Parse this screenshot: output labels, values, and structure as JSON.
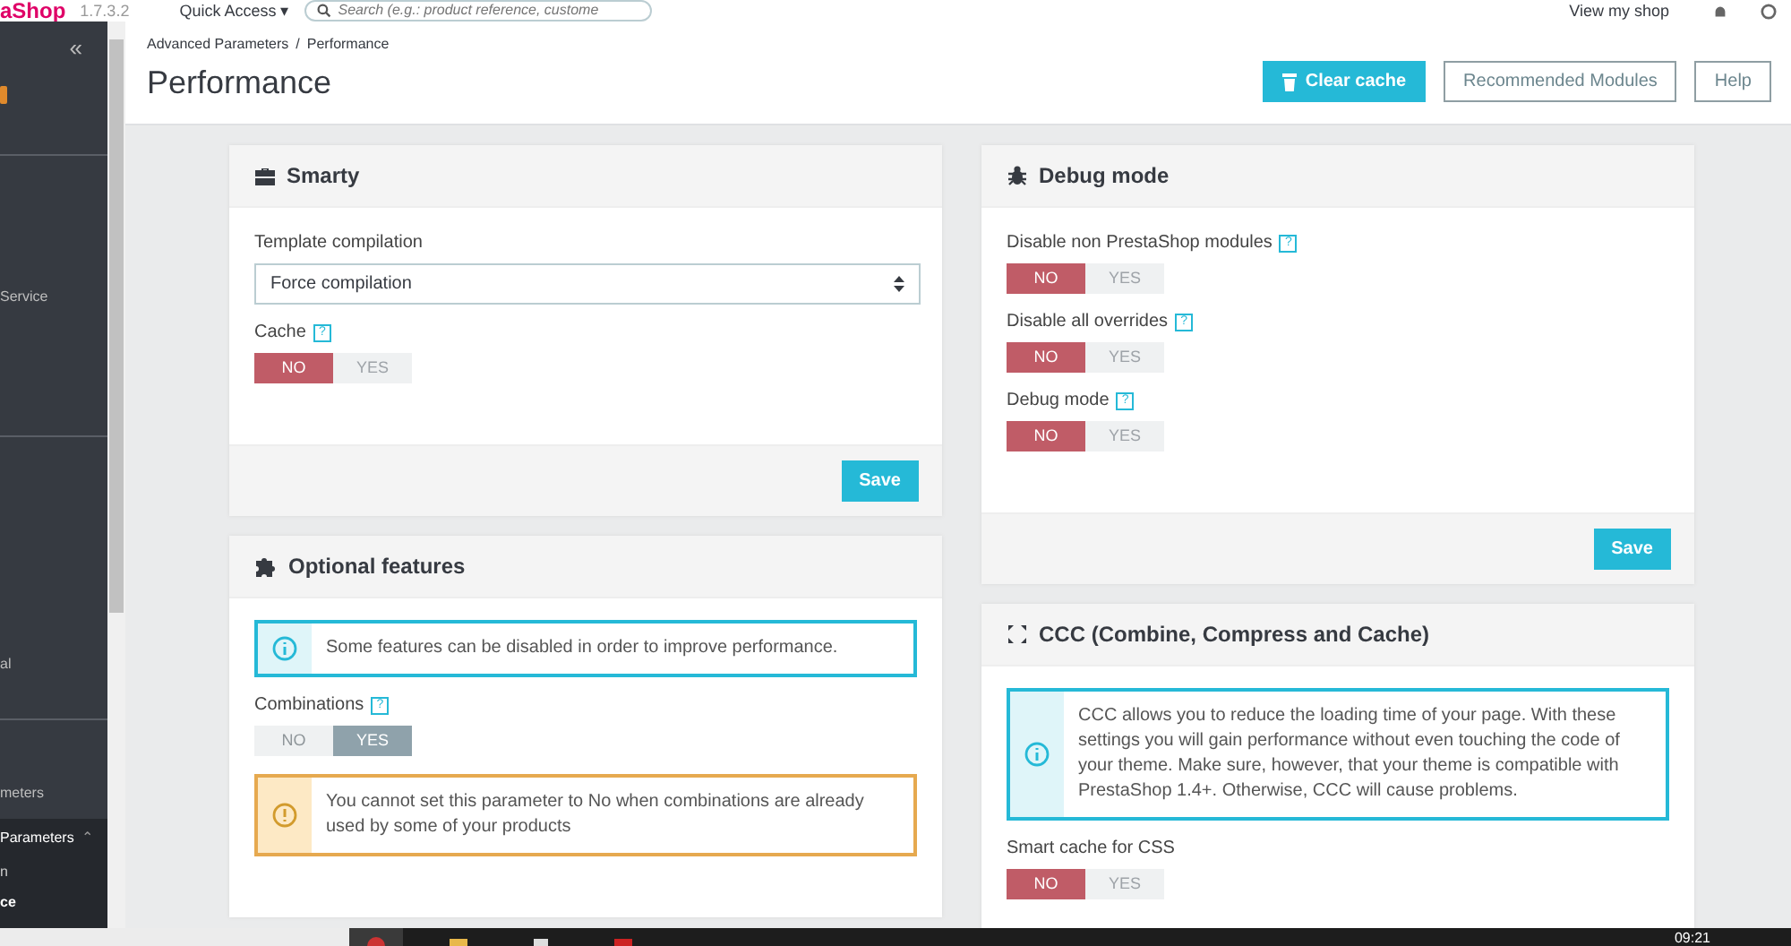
{
  "top_bar": {
    "logo": "aShop",
    "version": "1.7.3.2",
    "quick_access": "Quick Access ▾",
    "search": {
      "placeholder": "Search (e.g.: product reference, custome"
    },
    "view_shop": "View my shop"
  },
  "sidebar": {
    "collapse": "«",
    "sections": [
      {
        "items": [
          {
            "label": "Service",
            "selected": false
          }
        ]
      },
      {
        "items": [
          {
            "label": "al",
            "selected": false
          }
        ]
      },
      {
        "items": [
          {
            "label": "meters",
            "selected": false
          },
          {
            "label": "Parameters",
            "caret": "⌃",
            "selected": false,
            "expanded": true,
            "children": [
              {
                "label": "n",
                "selected": false
              },
              {
                "label": "ce",
                "selected": true
              }
            ]
          }
        ]
      }
    ]
  },
  "breadcrumb": {
    "items": [
      "Advanced Parameters",
      "Performance"
    ],
    "separator": "/"
  },
  "title": "Performance",
  "toolbar": [
    {
      "label": "Clear cache",
      "kind": "primary"
    },
    {
      "label": "Recommended Modules",
      "kind": "default"
    },
    {
      "label": "Help",
      "kind": "default"
    }
  ],
  "columns": [
    [
      {
        "title": "Smarty",
        "fields": [
          {
            "kind": "select",
            "label": "Template compilation",
            "value": "Force compilation"
          },
          {
            "kind": "switch",
            "label": "Cache",
            "help": "?",
            "disabled": false,
            "options": [
              {
                "label": "NO",
                "selected": true
              },
              {
                "label": "YES",
                "selected": false
              }
            ]
          }
        ],
        "save": "Save"
      },
      {
        "title": "Optional features",
        "fields": [
          {
            "kind": "info",
            "text": "Some features can be disabled in order to improve performance."
          },
          {
            "kind": "switch",
            "label": "Combinations",
            "help": "?",
            "disabled": true,
            "options": [
              {
                "label": "NO",
                "selected": false
              },
              {
                "label": "YES",
                "selected": true
              }
            ]
          },
          {
            "kind": "warning",
            "text": "You cannot set this parameter to No when combinations are already used by some of your products"
          }
        ]
      }
    ],
    [
      {
        "title": "Debug mode",
        "fields": [
          {
            "kind": "switch",
            "label": "Disable non PrestaShop modules",
            "help": "?",
            "disabled": false,
            "options": [
              {
                "label": "NO",
                "selected": true
              },
              {
                "label": "YES",
                "selected": false
              }
            ]
          },
          {
            "kind": "switch",
            "label": "Disable all overrides",
            "help": "?",
            "disabled": false,
            "options": [
              {
                "label": "NO",
                "selected": true
              },
              {
                "label": "YES",
                "selected": false
              }
            ]
          },
          {
            "kind": "switch",
            "label": "Debug mode",
            "help": "?",
            "disabled": false,
            "options": [
              {
                "label": "NO",
                "selected": true
              },
              {
                "label": "YES",
                "selected": false
              }
            ]
          }
        ],
        "save": "Save"
      },
      {
        "title": "CCC (Combine, Compress and Cache)",
        "fields": [
          {
            "kind": "info",
            "text": "CCC allows you to reduce the loading time of your page. With these settings you will gain performance without even touching the code of your theme. Make sure, however, that your theme is compatible with PrestaShop 1.4+. Otherwise, CCC will cause problems."
          },
          {
            "kind": "switch",
            "label": "Smart cache for CSS",
            "disabled": false,
            "options": [
              {
                "label": "NO",
                "selected": true
              },
              {
                "label": "YES",
                "selected": false
              }
            ]
          }
        ]
      }
    ]
  ],
  "taskbar": {
    "clock": "09:21"
  }
}
